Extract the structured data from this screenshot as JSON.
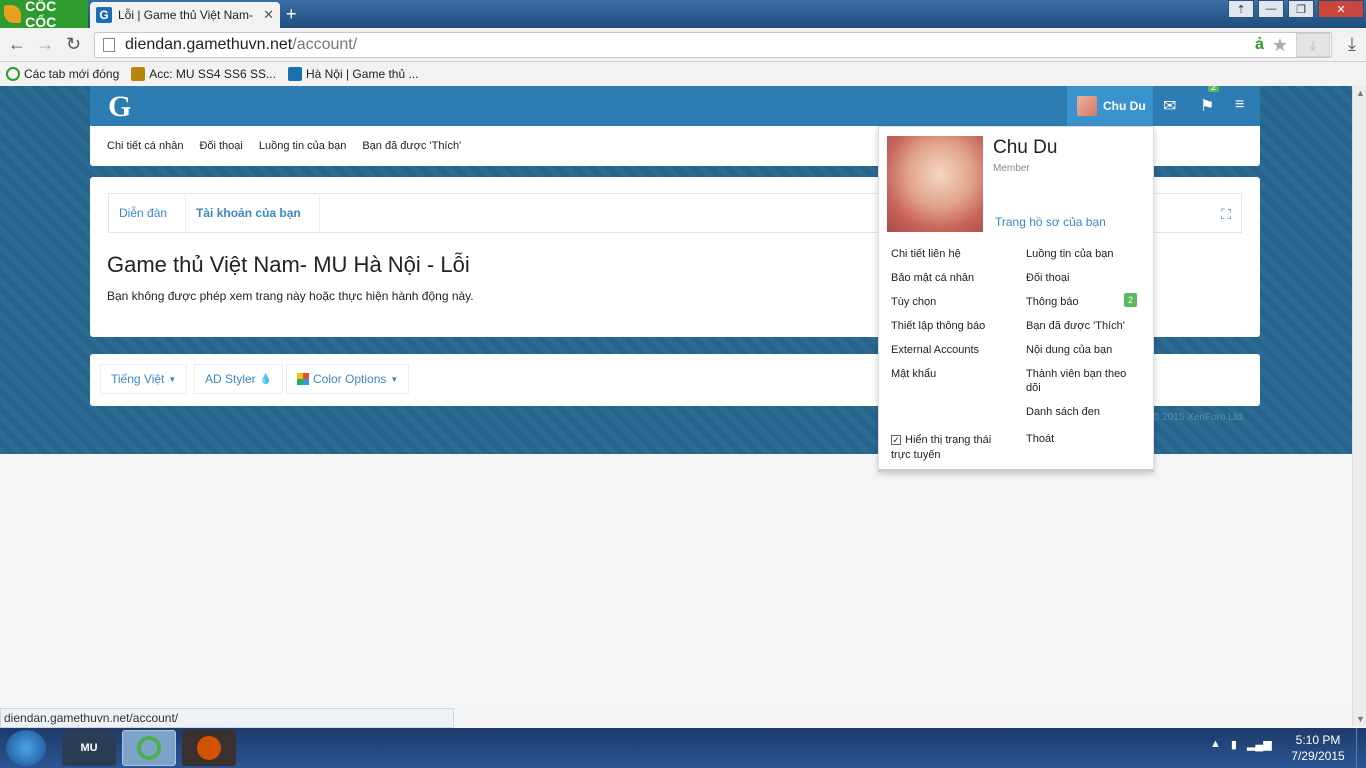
{
  "browser": {
    "brand": "CỐC CỐC",
    "tab_title": "Lỗi | Game thủ Việt Nam- I",
    "tab_favicon": "G",
    "url_host": "diendan.gamethuvn.net",
    "url_path": "/account/",
    "bookmarks": [
      {
        "label": "Các tab mới đóng",
        "icon": "recent-icon"
      },
      {
        "label": "Acc: MU SS4 SS6 SS...",
        "icon": "game-icon"
      },
      {
        "label": "Hà Nội | Game thủ ...",
        "icon": "g-icon"
      }
    ],
    "status_url": "diendan.gamethuvn.net/account/"
  },
  "site": {
    "logo": "G",
    "username": "Chu Du",
    "flag_badge": "2",
    "subnav": [
      "Chi tiết cá nhân",
      "Đối thoại",
      "Luồng tin của bạn",
      "Bạn đã được 'Thích'"
    ],
    "breadcrumbs": [
      "Diễn đàn",
      "Tài khoản của bạn"
    ],
    "heading": "Game thủ Việt Nam- MU Hà Nội - Lỗi",
    "message": "Bạn không được phép xem trang này hoặc thực hiện hành động này.",
    "footer": {
      "lang": "Tiếng Việt",
      "style": "AD Styler",
      "color": "Color Options"
    },
    "copyright": "© 2015 XenForo Ltd."
  },
  "user_menu": {
    "name": "Chu Du",
    "role": "Member",
    "profile_link": "Trang hồ sơ của bạn",
    "left": [
      "Chi tiết liên hệ",
      "Bảo mật cá nhân",
      "Tùy chọn",
      "Thiết lập thông báo",
      "External Accounts",
      "Mật khẩu"
    ],
    "right": [
      "Luồng tin của bạn",
      "Đối thoại",
      "Thông báo",
      "Bạn đã được 'Thích'",
      "Nội dung của bạn",
      "Thành viên bạn theo dõi",
      "Danh sách đen"
    ],
    "notif_count": "2",
    "online_status": "Hiển thị trạng thái trực tuyến",
    "logout": "Thoát"
  },
  "taskbar": {
    "time": "5:10 PM",
    "date": "7/29/2015",
    "apps": [
      "MU",
      "Cốc Cốc",
      "Game"
    ]
  },
  "colors": {
    "header": "#2d7db3",
    "accent": "#3a88c6",
    "badge": "#5cb85c"
  }
}
